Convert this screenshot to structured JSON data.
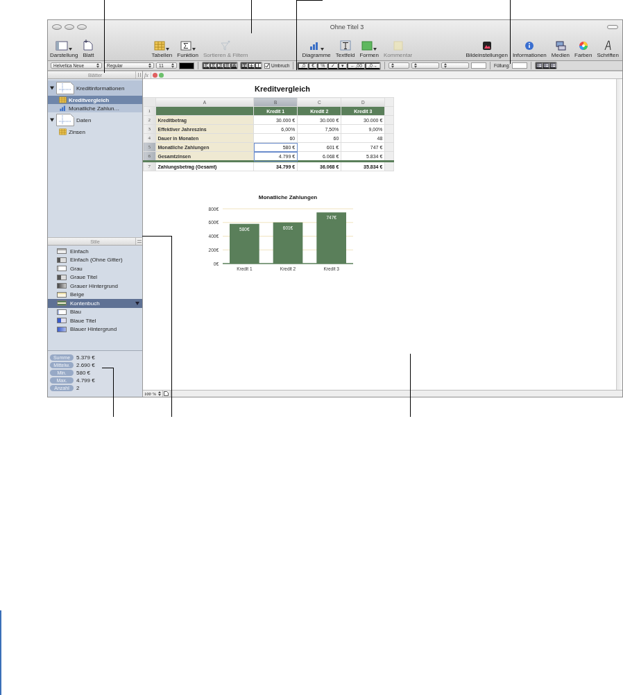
{
  "window": {
    "title": "Ohne Titel 3"
  },
  "toolbar": [
    {
      "items": [
        {
          "kind": "view",
          "label": "Darstellung",
          "menu": true,
          "disabled": false
        },
        {
          "kind": "sheet",
          "label": "Blatt",
          "menu": false,
          "disabled": false
        }
      ]
    },
    {
      "items": [
        {
          "kind": "table",
          "label": "Tabellen",
          "menu": true,
          "disabled": false
        },
        {
          "kind": "function",
          "label": "Funktion",
          "menu": true,
          "disabled": false
        },
        {
          "kind": "filter",
          "label": "Sortieren & Filtern",
          "menu": false,
          "disabled": true
        }
      ]
    },
    {
      "items": [
        {
          "kind": "chart",
          "label": "Diagramme",
          "menu": true,
          "disabled": false
        },
        {
          "kind": "textbox",
          "label": "Textfeld",
          "menu": false,
          "disabled": false
        },
        {
          "kind": "shape",
          "label": "Formen",
          "menu": true,
          "disabled": false
        },
        {
          "kind": "comment",
          "label": "Kommentar",
          "menu": false,
          "disabled": true
        }
      ]
    },
    {
      "items": [
        {
          "kind": "image",
          "label": "Bildeinstellungen",
          "menu": false,
          "disabled": false
        },
        {
          "kind": "info",
          "label": "Informationen",
          "menu": false,
          "disabled": false
        },
        {
          "kind": "media",
          "label": "Medien",
          "menu": false,
          "disabled": false
        },
        {
          "kind": "colors",
          "label": "Farben",
          "menu": false,
          "disabled": false
        },
        {
          "kind": "fonts",
          "label": "Schriften",
          "menu": false,
          "disabled": false
        }
      ]
    }
  ],
  "format_bar": {
    "font": "Helvetica Neue",
    "style": "Regular",
    "size": "11",
    "text_align": [
      {
        "kind": "left",
        "selected": false
      },
      {
        "kind": "center",
        "selected": false
      },
      {
        "kind": "right",
        "selected": false
      },
      {
        "kind": "justify",
        "selected": false
      },
      {
        "kind": "auto",
        "selected": true
      }
    ],
    "vertical_align": [
      {
        "kind": "top",
        "selected": true
      },
      {
        "kind": "middle",
        "selected": false
      },
      {
        "kind": "bottom",
        "selected": false
      }
    ],
    "wrap": {
      "label": "Umbruch",
      "checked": true
    },
    "number_buttons": [
      ",0",
      "€",
      "%",
      "✓",
      "▾",
      "←,00",
      ",0→"
    ],
    "fill_label": "Füllung:"
  },
  "formula_bar": {
    "label": "fx"
  },
  "sidebar": {
    "sheets_title": "Blätter",
    "sheets": [
      {
        "label": "Kreditinformationen",
        "active": true,
        "expanded": true,
        "children": [
          {
            "label": "Kreditvergleich",
            "kind": "table",
            "selected": true
          },
          {
            "label": "Monatliche Zahlun…",
            "kind": "chart",
            "selected": false
          }
        ]
      },
      {
        "label": "Daten",
        "active": false,
        "expanded": true,
        "children": [
          {
            "label": "Zinsen",
            "kind": "table",
            "selected": false
          }
        ]
      }
    ],
    "styles_title": "Stile",
    "styles": [
      {
        "label": "Einfach",
        "kind": "plain",
        "selected": false
      },
      {
        "label": "Einfach (Ohne Gitter)",
        "kind": "plain-dark",
        "selected": false
      },
      {
        "label": "Grau",
        "kind": "gray",
        "selected": false
      },
      {
        "label": "Graue Titel",
        "kind": "gray-header",
        "selected": false
      },
      {
        "label": "Grauer Hintergrund",
        "kind": "gray-bg",
        "selected": false
      },
      {
        "label": "Beige",
        "kind": "beige",
        "selected": false
      },
      {
        "label": "Kontenbuch",
        "kind": "ledger",
        "selected": true
      },
      {
        "label": "Blau",
        "kind": "blue",
        "selected": false
      },
      {
        "label": "Blaue Titel",
        "kind": "blue-header",
        "selected": false
      },
      {
        "label": "Blauer Hintergrund",
        "kind": "blue-bg",
        "selected": false
      }
    ],
    "stats": [
      {
        "label": "Summe",
        "value": "5.379 €"
      },
      {
        "label": "Mittelw.",
        "value": "2.690 €"
      },
      {
        "label": "Min.",
        "value": "580 €"
      },
      {
        "label": "Max.",
        "value": "4.799 €"
      },
      {
        "label": "Anzahl",
        "value": "2"
      }
    ]
  },
  "table": {
    "title": "Kreditvergleich",
    "columns": [
      {
        "label": "A",
        "selected": false
      },
      {
        "label": "B",
        "selected": true
      },
      {
        "label": "C",
        "selected": false
      },
      {
        "label": "D",
        "selected": false
      }
    ],
    "rows": [
      {
        "number": "1",
        "kind": "header",
        "selected": false,
        "values": [
          "Kredit 1",
          "Kredit 2",
          "Kredit 3"
        ]
      },
      {
        "number": "2",
        "kind": "body",
        "selected": false,
        "label": "Kreditbetrag",
        "values": [
          "30.000 €",
          "30.000 €",
          "30.000 €"
        ]
      },
      {
        "number": "3",
        "kind": "body",
        "selected": false,
        "label": "Effektiver Jahreszins",
        "values": [
          "6,00%",
          "7,50%",
          "9,00%"
        ]
      },
      {
        "number": "4",
        "kind": "body",
        "selected": false,
        "label": "Dauer in Monaten",
        "values": [
          "60",
          "60",
          "48"
        ]
      },
      {
        "number": "5",
        "kind": "body",
        "selected": true,
        "label": "Monatliche Zahlungen",
        "values": [
          "580 €",
          "601 €",
          "747 €"
        ]
      },
      {
        "number": "6",
        "kind": "body",
        "selected": true,
        "label": "Gesamtzinsen",
        "values": [
          "4.799 €",
          "6.068 €",
          "5.834 €"
        ]
      },
      {
        "number": "7",
        "kind": "footer",
        "selected": false,
        "label": "Zahlungsbetrag (Gesamt)",
        "values": [
          "34.799 €",
          "36.068 €",
          "35.834 €"
        ]
      }
    ]
  },
  "chart": {
    "chart_data": {
      "type": "bar",
      "title": "Monatliche Zahlungen",
      "categories": [
        "Kredit 1",
        "Kredit 2",
        "Kredit 3"
      ],
      "series": [
        {
          "color": "#5a7f5a",
          "values": [
            580,
            601,
            747
          ]
        }
      ],
      "grid": true,
      "ylim": [
        0,
        800
      ],
      "yticks": [
        {
          "value": 0,
          "label": "0€"
        },
        {
          "value": 200,
          "label": "200€"
        },
        {
          "value": 400,
          "label": "400€"
        },
        {
          "value": 600,
          "label": "600€"
        },
        {
          "value": 800,
          "label": "800€"
        }
      ],
      "value_labels": [
        "580€",
        "601€",
        "747€"
      ]
    }
  },
  "zoom": {
    "value": "100 %"
  }
}
